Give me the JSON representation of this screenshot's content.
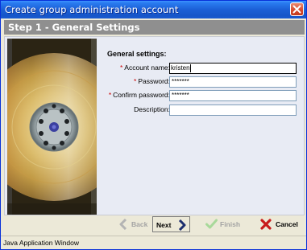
{
  "window": {
    "title": "Create group administration account"
  },
  "step": {
    "title": "Step 1 - General Settings"
  },
  "form": {
    "heading": "General settings:",
    "required_marker": "*",
    "fields": [
      {
        "label": "Account name:",
        "value": "kristen",
        "required": true
      },
      {
        "label": "Password:",
        "value": "*******",
        "required": true
      },
      {
        "label": "Confirm password:",
        "value": "*******",
        "required": true
      },
      {
        "label": "Description:",
        "value": "",
        "required": false
      }
    ]
  },
  "buttons": {
    "back": "Back",
    "next": "Next",
    "finish": "Finish",
    "cancel": "Cancel"
  },
  "status": {
    "text": "Java Application Window"
  },
  "colors": {
    "title_bar": "#1b5fd6",
    "step_header": "#8f8f8f",
    "required": "#cc0000",
    "next_arrow": "#1c2e6e",
    "finish_check": "#7fc66b",
    "cancel_x": "#c81b1b"
  }
}
